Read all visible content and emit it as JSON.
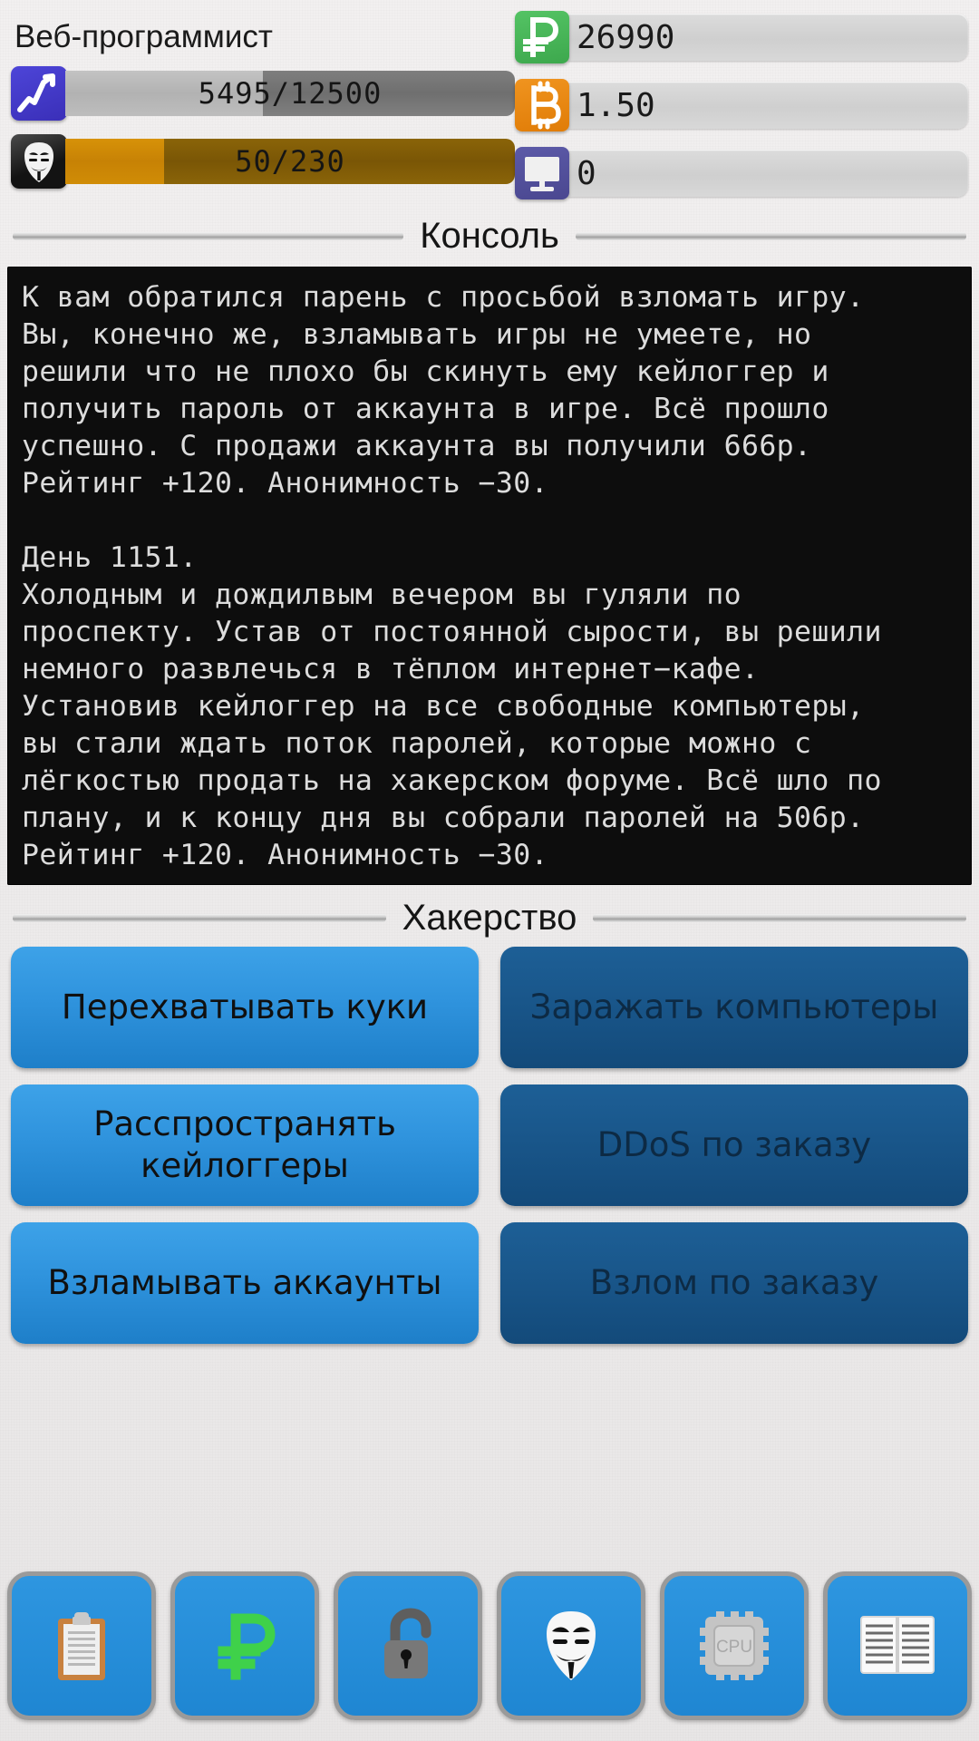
{
  "header": {
    "job_title": "Веб-программист",
    "bars": [
      {
        "name": "rating",
        "icon": "trend-chart-icon",
        "value_text": "5495/12500",
        "current": 5495,
        "max": 12500,
        "percent": 44,
        "icon_color": "#4338c8",
        "fill_color": "#bdbdbd",
        "track_color": "#757575"
      },
      {
        "name": "anonymity",
        "icon": "anonymous-mask-icon",
        "value_text": "50/230",
        "current": 50,
        "max": 230,
        "percent": 22,
        "icon_color": "#1a1a1a",
        "fill_color": "#cf8a06",
        "track_color": "#7f5a06"
      }
    ],
    "resources": [
      {
        "name": "rubles",
        "icon": "ruble-icon",
        "symbol": "₽",
        "value": "26990",
        "icon_color": "#46b256"
      },
      {
        "name": "bitcoin",
        "icon": "bitcoin-icon",
        "symbol": "₿",
        "value": "1.50",
        "icon_color": "#e8860f"
      },
      {
        "name": "computers",
        "icon": "monitor-icon",
        "symbol": "",
        "value": "0",
        "icon_color": "#524f9c"
      }
    ]
  },
  "console_section": {
    "title": "Консоль",
    "log": "К вам обратился парень с просьбой взломать игру.\nВы, конечно же, взламывать игры не умеете, но\nрешили что не плохо бы скинуть ему кейлоггер и\nполучить пароль от аккаунта в игре. Всё прошло\nуспешно. С продажи аккаунта вы получили 666р.\nРейтинг +120. Анонимность −30.\n\nДень 1151.\nХолодным и дождилвым вечером вы гуляли по\nпроспекту. Устав от постоянной сырости, вы решили\nнемного развлечься в тёплом интернет−кафе.\nУстановив кейлоггер на все свободные компьютеры,\nвы стали ждать поток паролей, которые можно с\nлёгкостью продать на хакерском форуме. Всё шло по\nплану, и к концу дня вы собрали паролей на 506р.\nРейтинг +120. Анонимность −30."
  },
  "hacking_section": {
    "title": "Хакерство",
    "buttons": [
      {
        "label": "Перехватывать куки",
        "state": "enabled"
      },
      {
        "label": "Заражать компьютеры",
        "state": "disabled"
      },
      {
        "label": "Расспространять\nкейлоггеры",
        "state": "enabled"
      },
      {
        "label": "DDoS по заказу",
        "state": "disabled"
      },
      {
        "label": "Взламывать аккаунты",
        "state": "enabled"
      },
      {
        "label": "Взлом по заказу",
        "state": "disabled"
      }
    ]
  },
  "bottom_nav": {
    "items": [
      {
        "name": "nav-tasks",
        "icon": "clipboard-icon"
      },
      {
        "name": "nav-finance",
        "icon": "ruble-icon"
      },
      {
        "name": "nav-security",
        "icon": "unlock-icon"
      },
      {
        "name": "nav-hacking",
        "icon": "anonymous-mask-icon"
      },
      {
        "name": "nav-hardware",
        "icon": "cpu-icon"
      },
      {
        "name": "nav-skills",
        "icon": "book-icon"
      }
    ],
    "cpu_label": "CPU"
  }
}
